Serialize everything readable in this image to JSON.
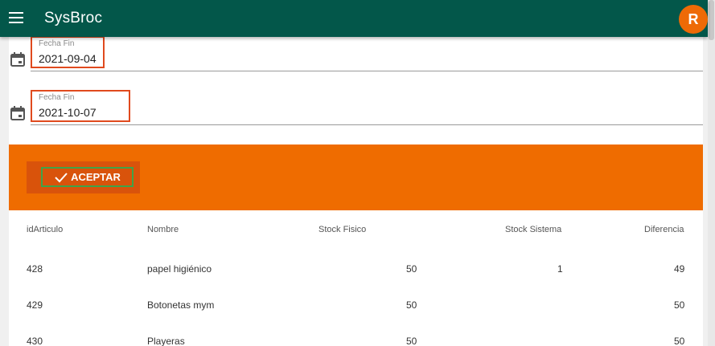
{
  "app": {
    "title": "SysBroc",
    "avatar_letter": "R"
  },
  "form": {
    "start_date": {
      "label": "Fecha Fin",
      "value": "2021-09-04"
    },
    "end_date": {
      "label": "Fecha Fin",
      "value": "2021-10-07"
    }
  },
  "actions": {
    "accept_label": "ACEPTAR"
  },
  "table": {
    "headers": [
      "idArticulo",
      "Nombre",
      "Stock Fisico",
      "Stock Sistema",
      "Diferencia"
    ],
    "rows": [
      [
        "428",
        "papel higiénico",
        "50",
        "1",
        "49"
      ],
      [
        "429",
        "Botonetas mym",
        "50",
        "",
        "50"
      ],
      [
        "430",
        "Playeras",
        "50",
        "",
        "50"
      ]
    ]
  },
  "colors": {
    "appbar": "#03574a",
    "accent": "#ef6c00",
    "highlight": "#e04a1e",
    "focus": "#3fa34a"
  },
  "icons": {
    "menu": "menu-icon",
    "calendar": "calendar-icon",
    "check": "check-icon"
  }
}
